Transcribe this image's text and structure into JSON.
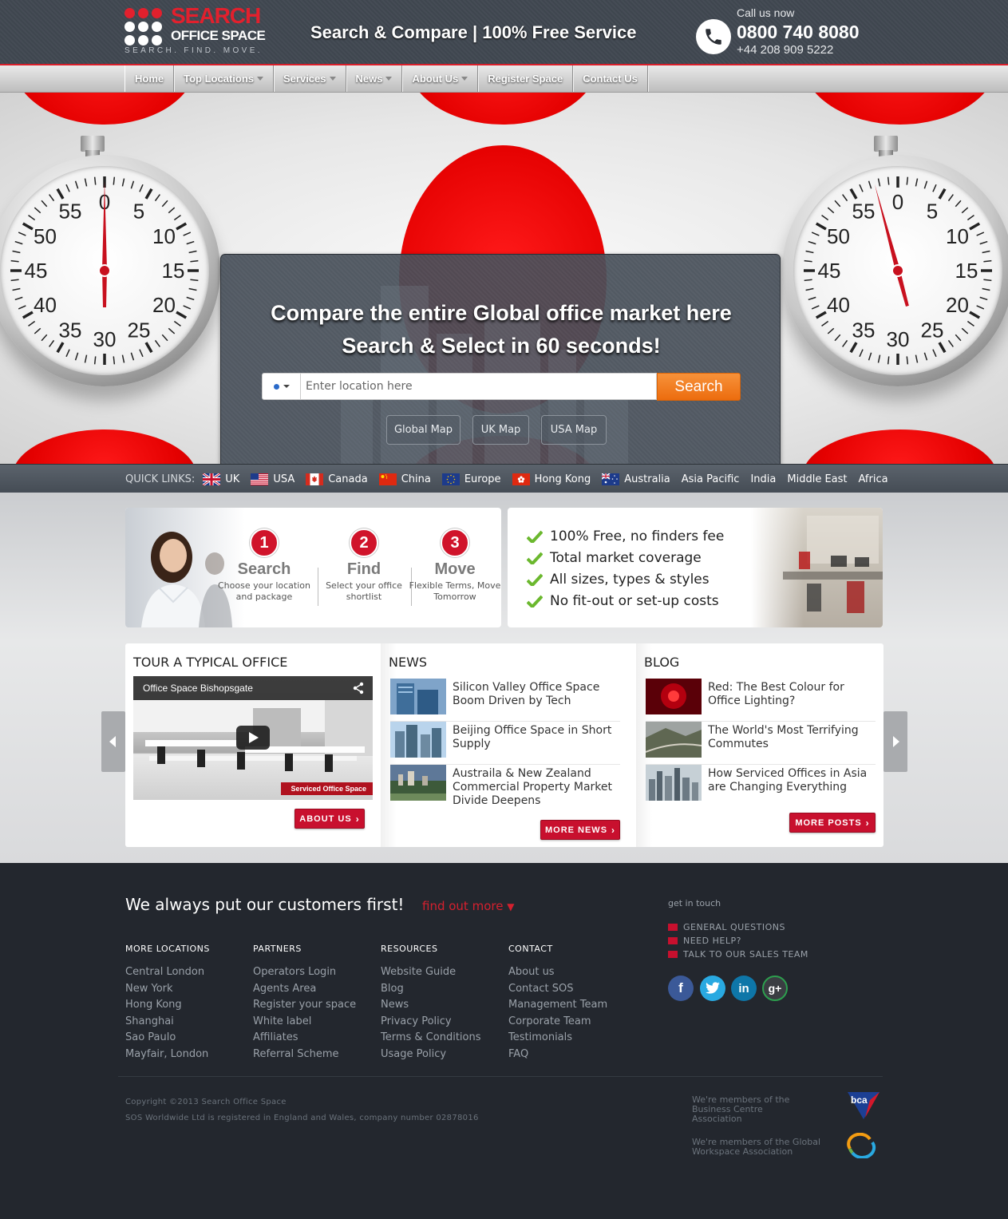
{
  "header": {
    "logo": {
      "line1": "SEARCH",
      "line2": "OFFICE SPACE",
      "tagline": "SEARCH. FIND. MOVE."
    },
    "tagline": "Search & Compare | 100% Free Service",
    "call_label": "Call us now",
    "phone": "0800 740 8080",
    "phone_intl": "+44 208 909 5222"
  },
  "nav": [
    {
      "label": "Home",
      "dropdown": false
    },
    {
      "label": "Top Locations",
      "dropdown": true
    },
    {
      "label": "Services",
      "dropdown": true
    },
    {
      "label": "News",
      "dropdown": true
    },
    {
      "label": "About Us",
      "dropdown": true
    },
    {
      "label": "Register Space",
      "dropdown": false
    },
    {
      "label": "Contact Us",
      "dropdown": false
    }
  ],
  "hero": {
    "headline1": "Compare the entire Global office market here",
    "headline2": "Search & Select in 60 seconds!",
    "search_placeholder": "Enter location here",
    "search_button": "Search",
    "map_buttons": [
      "Global Map",
      "UK Map",
      "USA Map"
    ],
    "dial_numbers": [
      "0",
      "5",
      "10",
      "15",
      "20",
      "25",
      "30",
      "35",
      "40",
      "45",
      "50",
      "55"
    ]
  },
  "quick_links": {
    "label": "QUICK LINKS:",
    "items": [
      "UK",
      "USA",
      "Canada",
      "China",
      "Europe",
      "Hong Kong",
      "Australia",
      "Asia Pacific",
      "India",
      "Middle East",
      "Africa"
    ]
  },
  "steps": [
    {
      "num": "1",
      "title": "Search",
      "desc": "Choose your location and package"
    },
    {
      "num": "2",
      "title": "Find",
      "desc": "Select your office shortlist"
    },
    {
      "num": "3",
      "title": "Move",
      "desc": "Flexible Terms, Move Tomorrow"
    }
  ],
  "benefits": [
    "100% Free, no finders fee",
    "Total market coverage",
    "All sizes, types & styles",
    "No fit-out or set-up costs"
  ],
  "tour": {
    "title": "TOUR A TYPICAL OFFICE",
    "video_title": "Office Space Bishopsgate",
    "video_tag": "Serviced Office Space",
    "button": "ABOUT US"
  },
  "news": {
    "title": "NEWS",
    "items": [
      "Silicon Valley Office Space Boom Driven by Tech",
      "Beijing Office Space in Short Supply",
      "Austraila & New Zealand Commercial Property Market Divide Deepens"
    ],
    "button": "MORE NEWS"
  },
  "blog": {
    "title": "BLOG",
    "items": [
      "Red: The Best Colour for Office Lighting?",
      "The World's Most Terrifying Commutes",
      "How Serviced Offices in Asia are Changing Everything"
    ],
    "button": "MORE POSTS"
  },
  "footer": {
    "headline": "We always put our customers first!",
    "find_more": "find out more",
    "columns": [
      {
        "title": "MORE LOCATIONS",
        "links": [
          "Central London",
          "New York",
          "Hong Kong",
          "Shanghai",
          "Sao Paulo",
          "Mayfair, London"
        ]
      },
      {
        "title": "PARTNERS",
        "links": [
          "Operators Login",
          "Agents Area",
          "Register your space",
          "White label",
          "Affiliates",
          "Referral Scheme"
        ]
      },
      {
        "title": "RESOURCES",
        "links": [
          "Website Guide",
          "Blog",
          "News",
          "Privacy Policy",
          "Terms & Conditions",
          "Usage Policy"
        ]
      },
      {
        "title": "CONTACT",
        "links": [
          "About us",
          "Contact SOS",
          "Management Team",
          "Corporate Team",
          "Testimonials",
          "FAQ"
        ]
      }
    ],
    "get_in_touch": "get in touch",
    "contact_links": [
      "GENERAL QUESTIONS",
      "NEED HELP?",
      "TALK TO OUR SALES TEAM"
    ],
    "social": [
      "f",
      "in",
      "g+"
    ],
    "copyright": "Copyright ©2013 Search Office Space",
    "registration": "SOS Worldwide Ltd is registered in England and Wales, company number 02878016",
    "member1": "We're members of the Business Centre Association",
    "member2": "We're members of the Global Workspace Association",
    "bca_logo": "bca"
  },
  "colors": {
    "brand_red": "#d81e2a",
    "search_orange": "#f0791c",
    "header_bg": "#424951",
    "footer_bg": "#23272e"
  }
}
